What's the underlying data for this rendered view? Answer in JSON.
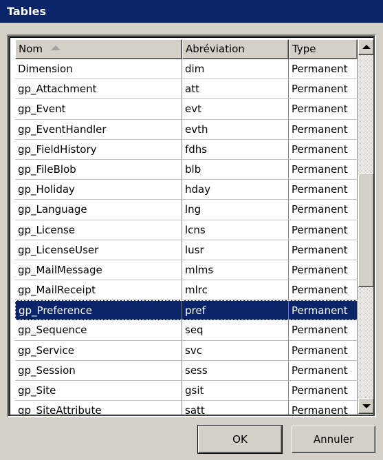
{
  "window": {
    "title": "Tables"
  },
  "table": {
    "columns": [
      {
        "label": "Nom",
        "sorted": "ascending"
      },
      {
        "label": "Abréviation"
      },
      {
        "label": "Type"
      }
    ],
    "rows": [
      {
        "name": "Dimension",
        "abbr": "dim",
        "type": "Permanent"
      },
      {
        "name": "gp_Attachment",
        "abbr": "att",
        "type": "Permanent"
      },
      {
        "name": "gp_Event",
        "abbr": "evt",
        "type": "Permanent"
      },
      {
        "name": "gp_EventHandler",
        "abbr": "evth",
        "type": "Permanent"
      },
      {
        "name": "gp_FieldHistory",
        "abbr": "fdhs",
        "type": "Permanent"
      },
      {
        "name": "gp_FileBlob",
        "abbr": "blb",
        "type": "Permanent"
      },
      {
        "name": "gp_Holiday",
        "abbr": "hday",
        "type": "Permanent"
      },
      {
        "name": "gp_Language",
        "abbr": "lng",
        "type": "Permanent"
      },
      {
        "name": "gp_License",
        "abbr": "lcns",
        "type": "Permanent"
      },
      {
        "name": "gp_LicenseUser",
        "abbr": "lusr",
        "type": "Permanent"
      },
      {
        "name": "gp_MailMessage",
        "abbr": "mlms",
        "type": "Permanent"
      },
      {
        "name": "gp_MailReceipt",
        "abbr": "mlrc",
        "type": "Permanent"
      },
      {
        "name": "gp_Preference",
        "abbr": "pref",
        "type": "Permanent"
      },
      {
        "name": "gp_Sequence",
        "abbr": "seq",
        "type": "Permanent"
      },
      {
        "name": "gp_Service",
        "abbr": "svc",
        "type": "Permanent"
      },
      {
        "name": "gp_Session",
        "abbr": "sess",
        "type": "Permanent"
      },
      {
        "name": "gp_Site",
        "abbr": "gsit",
        "type": "Permanent"
      },
      {
        "name": "gp_SiteAttribute",
        "abbr": "satt",
        "type": "Permanent"
      }
    ],
    "selected_row": 12
  },
  "buttons": {
    "ok": "OK",
    "cancel": "Annuler"
  },
  "colors": {
    "titlebar": "#0a246a",
    "selection": "#0a246a",
    "face": "#d4d0c8"
  }
}
